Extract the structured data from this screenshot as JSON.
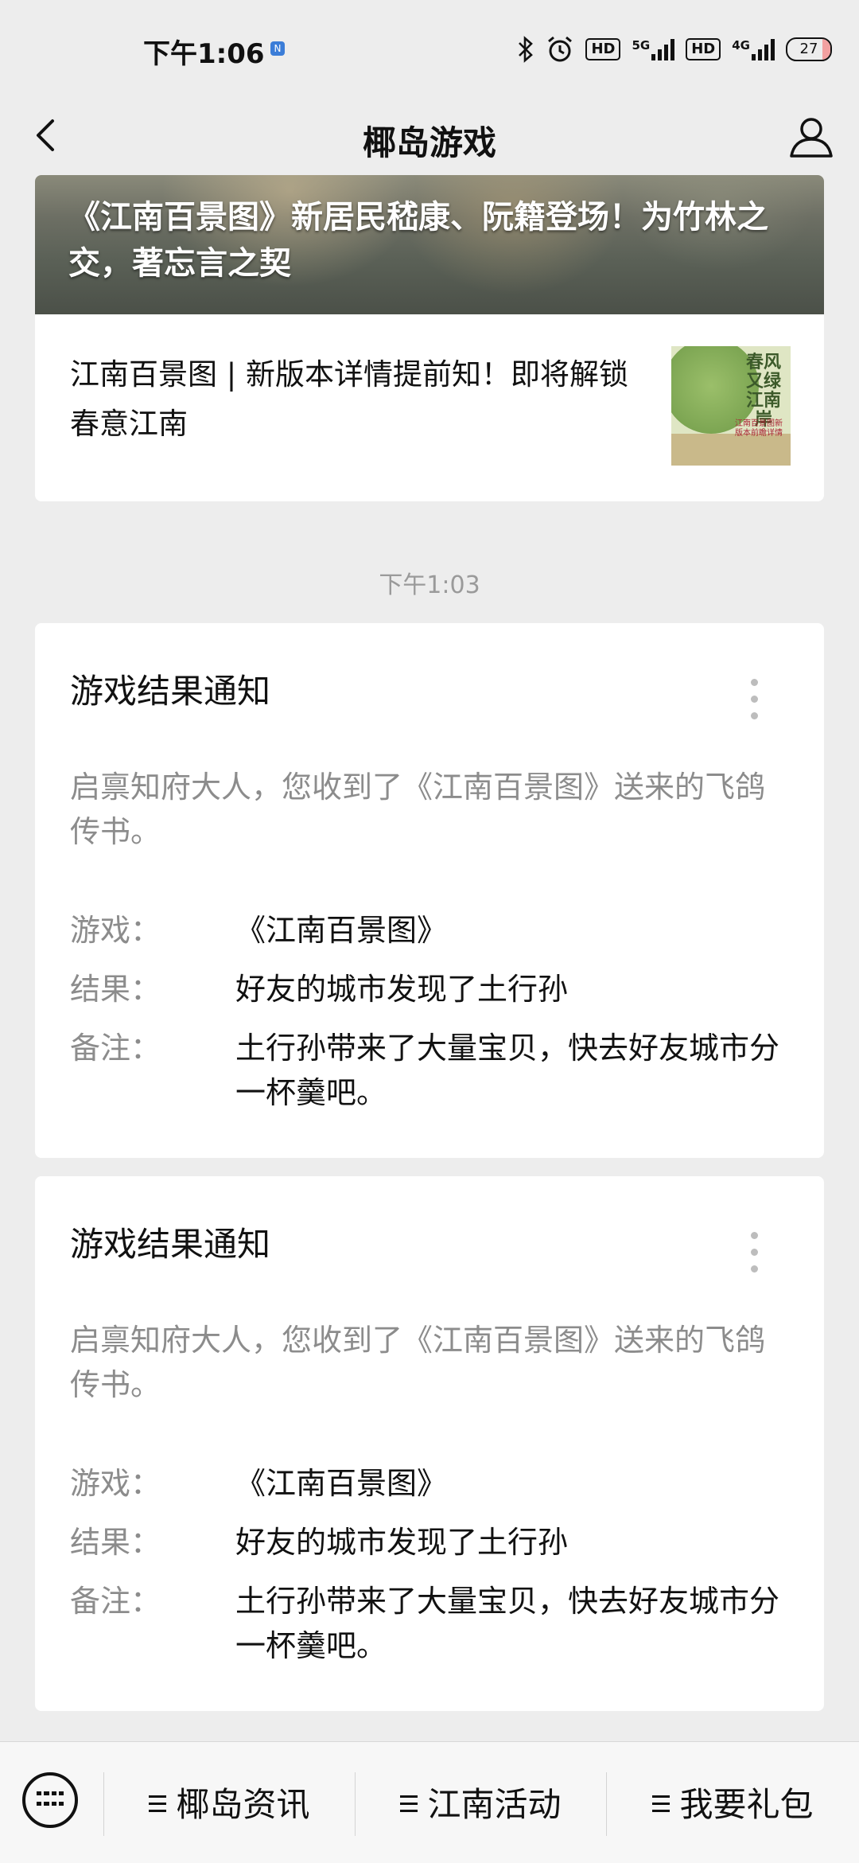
{
  "status_bar": {
    "time": "下午1:06",
    "network_5g": "5G",
    "network_4g": "4G",
    "hd_badge": "HD",
    "battery": "27"
  },
  "nav": {
    "title": "椰岛游戏"
  },
  "article": {
    "banner_title": "《江南百景图》新居民嵇康、阮籍登场！为竹林之交，著忘言之契",
    "sub_title": "江南百景图 | 新版本详情提前知！即将解锁春意江南",
    "thumb_title": "春风又绿江南岸",
    "thumb_subtitle": "江南百景图新版本前瞻详情"
  },
  "timestamp": "下午1:03",
  "notifications": [
    {
      "title": "游戏结果通知",
      "intro": "启禀知府大人，您收到了《江南百景图》送来的飞鸽传书。",
      "fields": [
        {
          "label": "游戏：",
          "value": "《江南百景图》"
        },
        {
          "label": "结果：",
          "value": "好友的城市发现了土行孙"
        },
        {
          "label": "备注：",
          "value": "土行孙带来了大量宝贝，快去好友城市分一杯羹吧。"
        }
      ]
    },
    {
      "title": "游戏结果通知",
      "intro": "启禀知府大人，您收到了《江南百景图》送来的飞鸽传书。",
      "fields": [
        {
          "label": "游戏：",
          "value": "《江南百景图》"
        },
        {
          "label": "结果：",
          "value": "好友的城市发现了土行孙"
        },
        {
          "label": "备注：",
          "value": "土行孙带来了大量宝贝，快去好友城市分一杯羹吧。"
        }
      ]
    }
  ],
  "bottom_menu": {
    "items": [
      "椰岛资讯",
      "江南活动",
      "我要礼包"
    ]
  }
}
